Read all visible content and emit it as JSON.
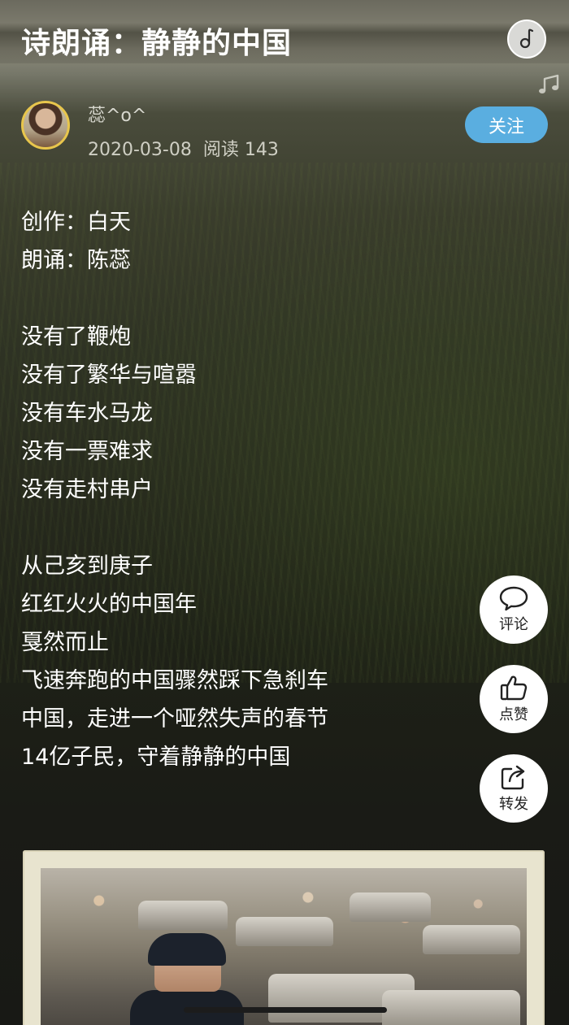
{
  "header": {
    "title": "诗朗诵：静静的中国"
  },
  "author": {
    "name": "蕊^o^",
    "date": "2020-03-08",
    "reads": "阅读 143",
    "follow_label": "关注"
  },
  "poem": {
    "credits": [
      "创作：白天",
      "朗诵：陈蕊"
    ],
    "stanza1": [
      "没有了鞭炮",
      "没有了繁华与喧嚣",
      "没有车水马龙",
      "没有一票难求",
      "没有走村串户"
    ],
    "stanza2": [
      "从己亥到庚子",
      "红红火火的中国年",
      "戛然而止",
      "飞速奔跑的中国骤然踩下急刹车",
      "中国，走进一个哑然失声的春节",
      "14亿子民，守着静静的中国"
    ]
  },
  "actions": {
    "comment_label": "评论",
    "like_label": "点赞",
    "share_label": "转发"
  },
  "colors": {
    "follow_button": "#5aaee0",
    "avatar_ring": "#e8c64c",
    "action_button_bg": "#ffffff",
    "photo_frame": "#e8e4cf"
  },
  "icons": {
    "music": "music-disc-icon",
    "note": "music-note-icon",
    "comment": "comment-bubble-icon",
    "like": "thumbs-up-icon",
    "share": "share-icon"
  }
}
